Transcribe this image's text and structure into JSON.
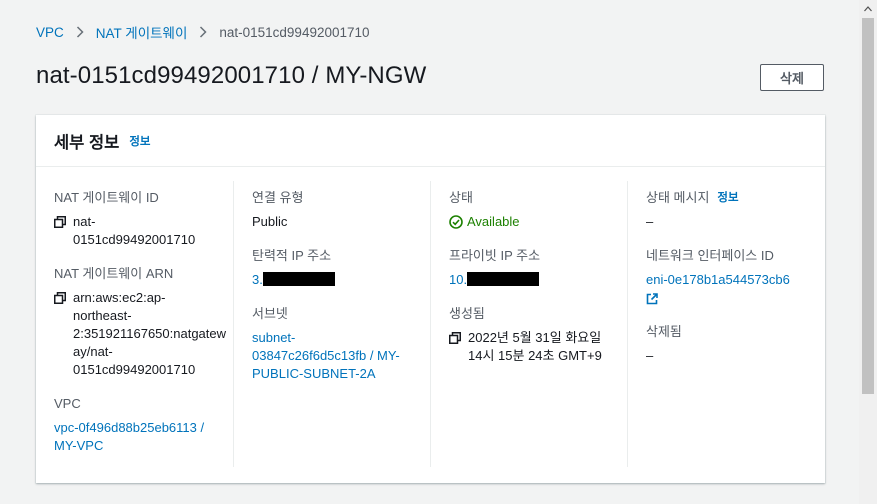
{
  "breadcrumb": {
    "items": [
      "VPC",
      "NAT 게이트웨이"
    ],
    "current": "nat-0151cd99492001710"
  },
  "page": {
    "title": "nat-0151cd99492001710 / MY-NGW",
    "delete_label": "삭제"
  },
  "panel": {
    "title": "세부 정보",
    "info_label": "정보"
  },
  "details": {
    "nat_id": {
      "label": "NAT 게이트웨이 ID",
      "value_line1": "nat-",
      "value_line2": "0151cd99492001710"
    },
    "nat_arn": {
      "label": "NAT 게이트웨이 ARN",
      "lines": [
        "arn:aws:ec2:ap-",
        "northeast-",
        "2:351921167650:natgatew",
        "ay/nat-",
        "0151cd99492001710"
      ]
    },
    "vpc": {
      "label": "VPC",
      "lines": [
        "vpc-0f496d88b25eb6113 /",
        "MY-VPC"
      ]
    },
    "connectivity": {
      "label": "연결 유형",
      "value": "Public"
    },
    "elastic_ip": {
      "label": "탄력적 IP 주소",
      "value_prefix": "3."
    },
    "subnet": {
      "label": "서브넷",
      "lines": [
        "subnet-",
        "03847c26f6d5c13fb / MY-",
        "PUBLIC-SUBNET-2A"
      ]
    },
    "state": {
      "label": "상태",
      "value": "Available"
    },
    "private_ip": {
      "label": "프라이빗 IP 주소",
      "value_prefix": "10."
    },
    "created": {
      "label": "생성됨",
      "lines": [
        "2022년 5월 31일 화요일",
        "14시 15분 24초 GMT+9"
      ]
    },
    "state_message": {
      "label": "상태 메시지",
      "info_label": "정보",
      "value": "–"
    },
    "eni": {
      "label": "네트워크 인터페이스 ID",
      "value": "eni-0e178b1a544573cb6"
    },
    "deleted": {
      "label": "삭제됨",
      "value": "–"
    }
  },
  "colors": {
    "link": "#0073bb",
    "success": "#1d8102",
    "background": "#f2f3f3"
  }
}
